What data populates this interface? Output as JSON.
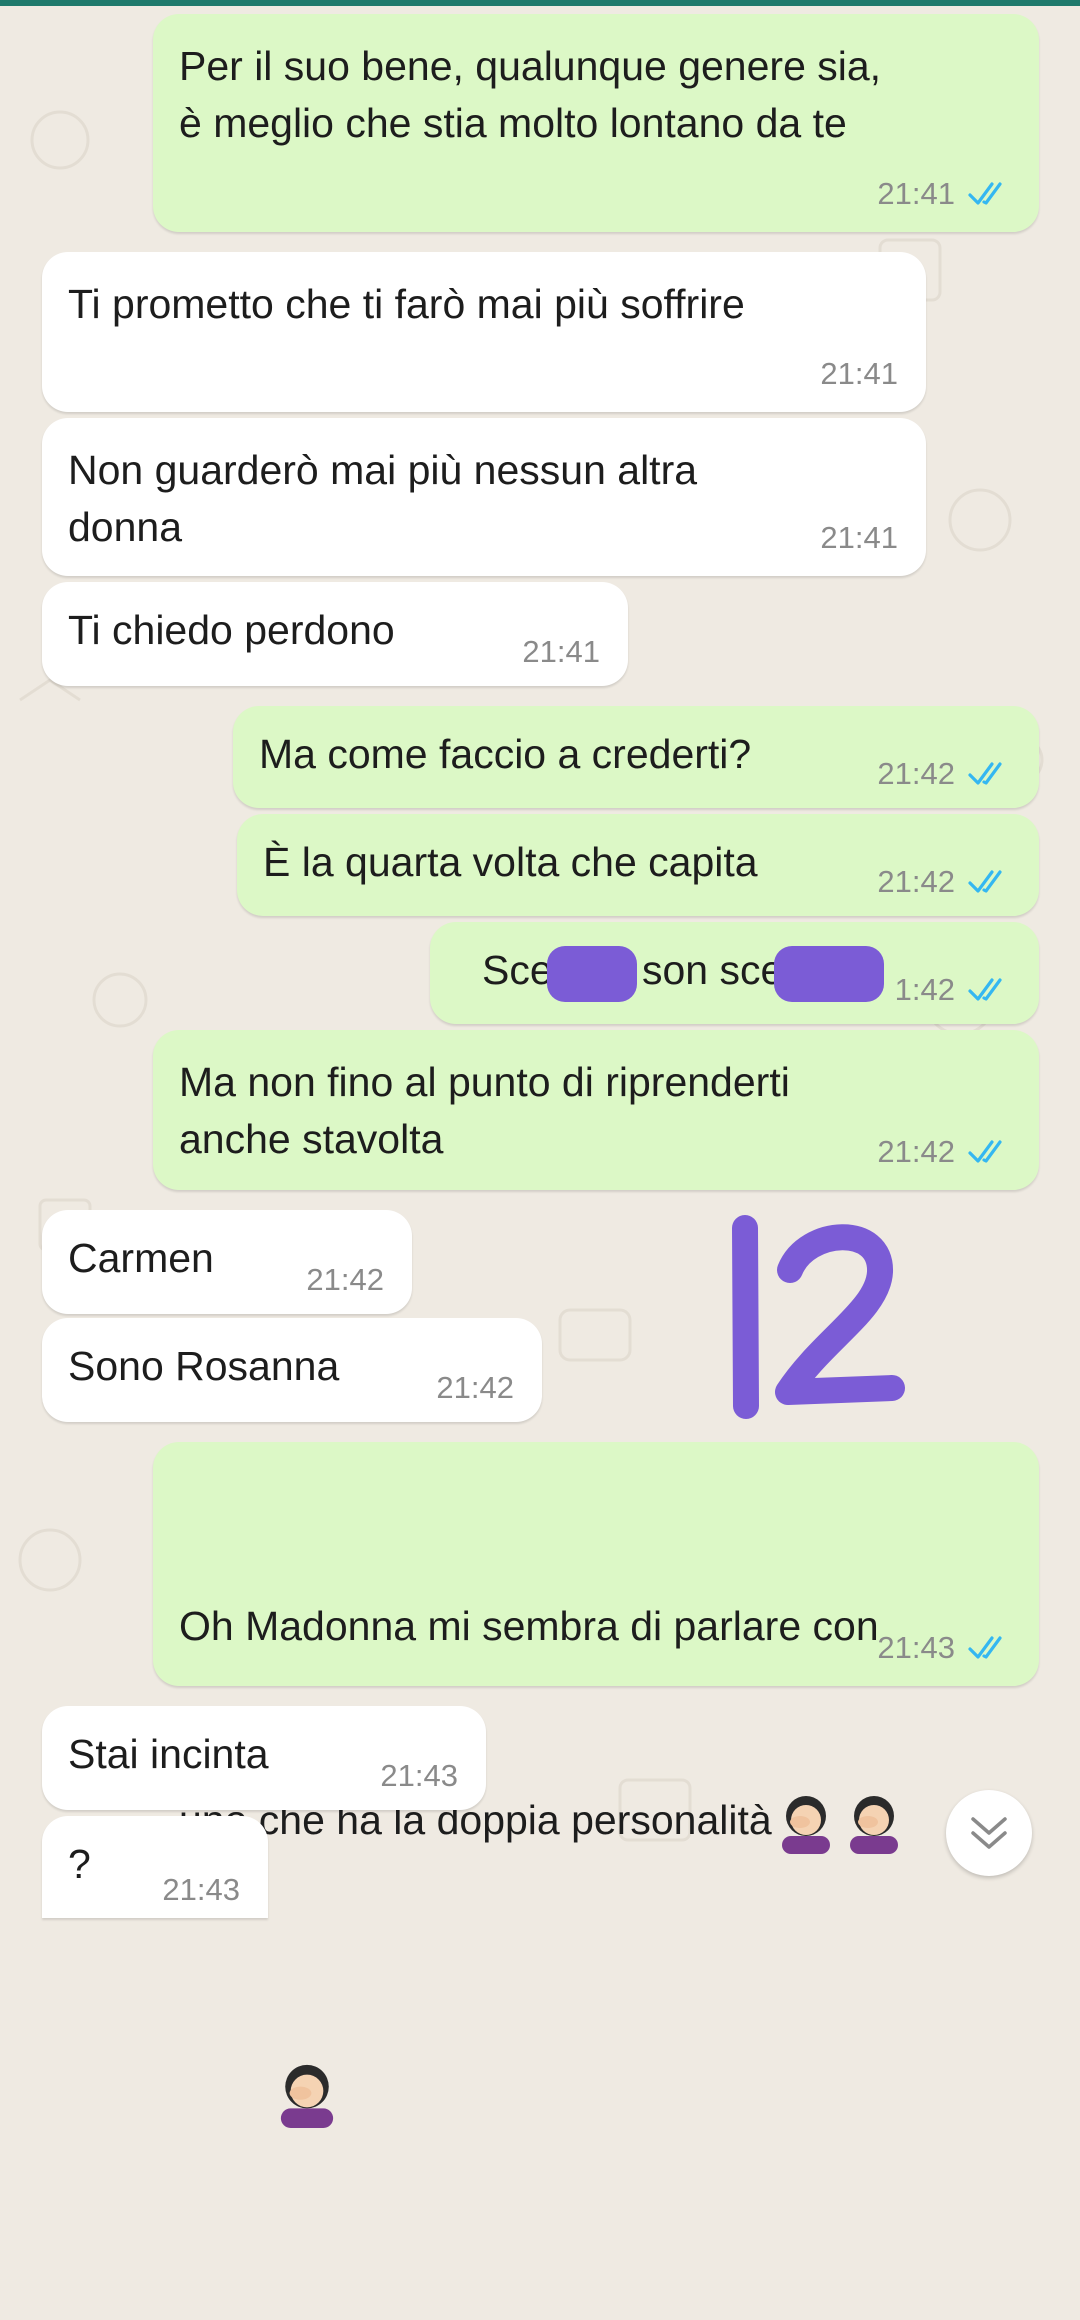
{
  "messages": [
    {
      "id": "m1",
      "dir": "out",
      "text": "Per il suo bene, qualunque genere sia,\nè meglio che stia molto lontano da te",
      "time": "21:41"
    },
    {
      "id": "m2",
      "dir": "in",
      "text": "Ti prometto che ti farò mai più soffrire",
      "time": "21:41"
    },
    {
      "id": "m3",
      "dir": "in",
      "text": "Non guarderò mai più nessun altra\ndonna",
      "time": "21:41"
    },
    {
      "id": "m4",
      "dir": "in",
      "text": "Ti chiedo perdono",
      "time": "21:41"
    },
    {
      "id": "m5",
      "dir": "out",
      "text": "Ma come faccio a crederti?",
      "time": "21:42"
    },
    {
      "id": "m6",
      "dir": "out",
      "text": "È la quarta volta che capita",
      "time": "21:42"
    },
    {
      "id": "m7",
      "dir": "out",
      "text_a": "Sce",
      "text_b": "son sce",
      "time": "1:42"
    },
    {
      "id": "m8",
      "dir": "out",
      "text": "Ma non fino al punto di riprenderti\nanche stavolta",
      "time": "21:42"
    },
    {
      "id": "m9",
      "dir": "in",
      "text": "Carmen",
      "time": "21:42"
    },
    {
      "id": "m10",
      "dir": "in",
      "text": "Sono Rosanna",
      "time": "21:42"
    },
    {
      "id": "m11",
      "dir": "out",
      "text_line1": "Oh Madonna mi sembra di parlare con",
      "text_line2": "uno che ha la doppia personalità",
      "time": "21:43"
    },
    {
      "id": "m12",
      "dir": "in",
      "text": "Stai incinta",
      "time": "21:43"
    },
    {
      "id": "m13",
      "dir": "in",
      "text": "?",
      "time": "21:43"
    }
  ],
  "annotation": {
    "text": "12",
    "color": "#7b5cd6"
  },
  "colors": {
    "outgoing": "#dcf8c6",
    "incoming": "#ffffff",
    "read_tick": "#34b7f1",
    "background": "#efeae2"
  },
  "icons": {
    "read_receipt": "double-check-icon",
    "emoji": "woman-facepalming-emoji",
    "scroll": "chevron-down-icon"
  }
}
